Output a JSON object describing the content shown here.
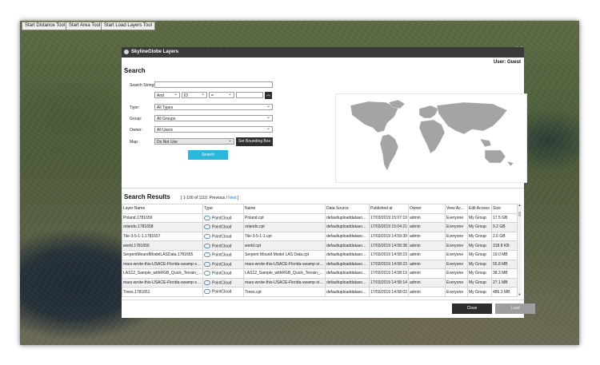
{
  "toolbar": {
    "distance": "Start Distance Tool",
    "area": "Start Area Tool",
    "load_layers": "Start Load Layers Tool"
  },
  "dialog": {
    "title": "SkylineGlobe Layers",
    "user_label": "User:",
    "user_name": "Guest",
    "close_icon": "close-icon"
  },
  "search": {
    "heading": "Search",
    "search_string_label": "Search String:",
    "search_string_value": "",
    "logic_op": "And",
    "field": "ID",
    "comparator": "=",
    "value": "",
    "type_label": "Type:",
    "type_value": "All Types",
    "group_label": "Group:",
    "group_value": "All Groups",
    "owner_label": "Owner:",
    "owner_value": "All Users",
    "map_label": "Map:",
    "map_value": "Do Not Use",
    "bounding_box_button": "Set Bounding Box",
    "search_button": "Search"
  },
  "results": {
    "heading": "Search Results",
    "meta_prefix": "[ 1-100 of 1110. Previous / ",
    "meta_next": "Next",
    "meta_suffix": " ]",
    "columns": [
      "Layer Name",
      "Type",
      "Name",
      "Data Source",
      "Published at",
      "Owner",
      "View Access",
      "Edit Access",
      "Size"
    ],
    "rows": [
      [
        "Poland.1781659",
        "PointCloud",
        "Poland.cpt",
        "defaultuploaddatasource",
        "17/03/2019 15:07:19",
        "admin",
        "Everyone",
        "My Group",
        "17.5 GB"
      ],
      [
        "orlando.1781658",
        "PointCloud",
        "orlando.cpt",
        "defaultuploaddatasource",
        "17/03/2019 15:04:21",
        "admin",
        "Everyone",
        "My Group",
        "9.2 GB"
      ],
      [
        "Tile-3-5-1-1.1781657",
        "PointCloud",
        "Tile-3-5-1-1.cpt",
        "defaultuploaddatasource",
        "17/03/2019 14:59:39",
        "admin",
        "Everyone",
        "My Group",
        "2.6 GB"
      ],
      [
        "world.1781656",
        "PointCloud",
        "world.cpt",
        "defaultuploaddatasource",
        "17/03/2019 14:58:38",
        "admin",
        "Everyone",
        "My Group",
        "318.8 KB"
      ],
      [
        "SerpentMoundModelLASData.1781655",
        "PointCloud",
        "Serpent Mound Model LAS Data.cpt",
        "defaultuploaddatasource",
        "17/03/2019 14:58:23",
        "admin",
        "Everyone",
        "My Group",
        "19.0 MB"
      ],
      [
        "mars-wrote-this-USACE-Florida-swamp-sta...",
        "PointCloud",
        "mars-wrote-this-USACE-Florida-swamp-sta...",
        "defaultuploaddatasource",
        "17/03/2019 14:58:23",
        "admin",
        "Everyone",
        "My Group",
        "55.8 MB"
      ],
      [
        "LAS12_Sample_withRGB_Quick_Terrain_...",
        "PointCloud",
        "LAS12_Sample_withRGB_Quick_Terrain_...",
        "defaultuploaddatasource",
        "17/03/2019 14:58:19",
        "admin",
        "Everyone",
        "My Group",
        "38.3 MB"
      ],
      [
        "mars-wrote-this-USACE-Florida-swamp-sta...",
        "PointCloud",
        "mars-wrote-this-USACE-Florida-swamp-sta...",
        "defaultuploaddatasource",
        "17/03/2019 14:58:14",
        "admin",
        "Everyone",
        "My Group",
        "27.1 MB"
      ],
      [
        "Trees.1781651",
        "PointCloud",
        "Trees.cpt",
        "defaultuploaddatasource",
        "17/03/2019 14:58:03",
        "admin",
        "Everyone",
        "My Group",
        "486.3 MB"
      ]
    ]
  },
  "footer": {
    "close_button": "Close",
    "load_button": "Load"
  }
}
